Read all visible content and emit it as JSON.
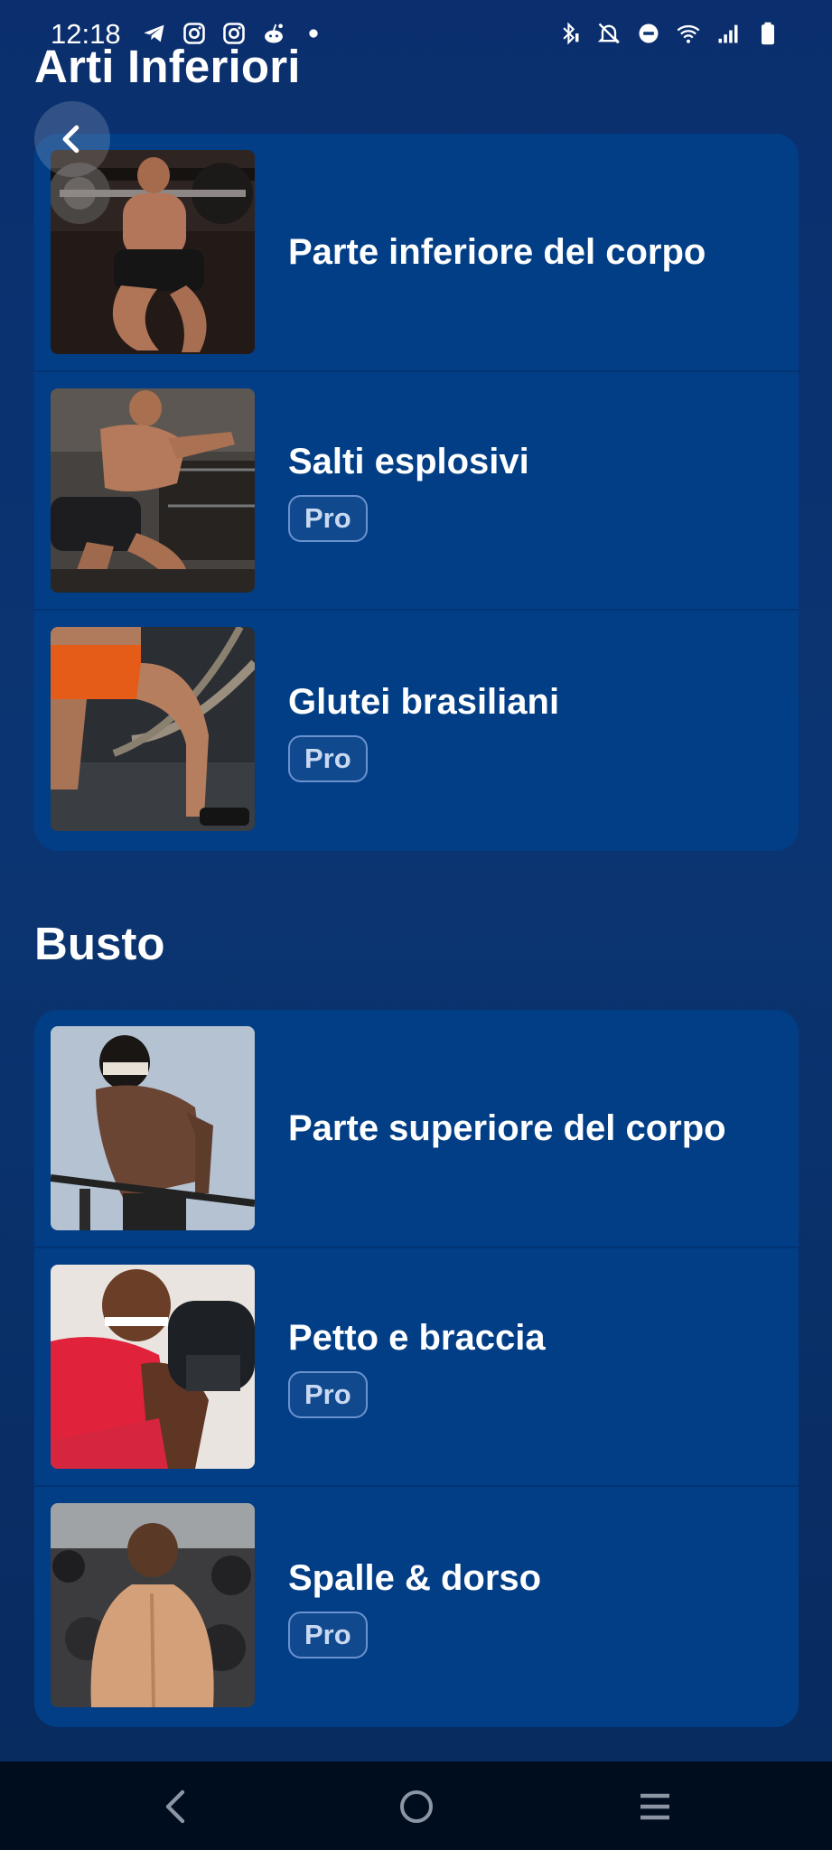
{
  "status_bar": {
    "time": "12:18",
    "left_icons": [
      "telegram-icon",
      "instagram-icon",
      "instagram-icon",
      "reddit-icon",
      "dot-icon"
    ],
    "right_icons": [
      "bluetooth-icon",
      "mute-icon",
      "do-not-disturb-icon",
      "wifi-icon",
      "signal-icon",
      "battery-icon"
    ]
  },
  "header": {
    "title": "Arti Inferiori"
  },
  "sections": [
    {
      "items": [
        {
          "title": "Parte inferiore del corpo",
          "badge": null,
          "image": "barbell squat photo"
        },
        {
          "title": "Salti esplosivi",
          "badge": "Pro",
          "image": "box jump photo"
        },
        {
          "title": "Glutei brasiliani",
          "badge": "Pro",
          "image": "battle rope photo"
        }
      ]
    },
    {
      "title": "Busto",
      "items": [
        {
          "title": "Parte superiore del corpo",
          "badge": null,
          "image": "bar dips photo"
        },
        {
          "title": "Petto e braccia",
          "badge": "Pro",
          "image": "dumbbell curl photo"
        },
        {
          "title": "Spalle & dorso",
          "badge": "Pro",
          "image": "back on rocks photo"
        }
      ]
    }
  ],
  "nav_bar": {
    "icons": [
      "back-nav-icon",
      "home-nav-icon",
      "recents-nav-icon"
    ]
  },
  "colors": {
    "background": "#0b3572",
    "card": "#023e86",
    "badge_border": "#6a92cf",
    "nav_bar": "#000d1e"
  }
}
